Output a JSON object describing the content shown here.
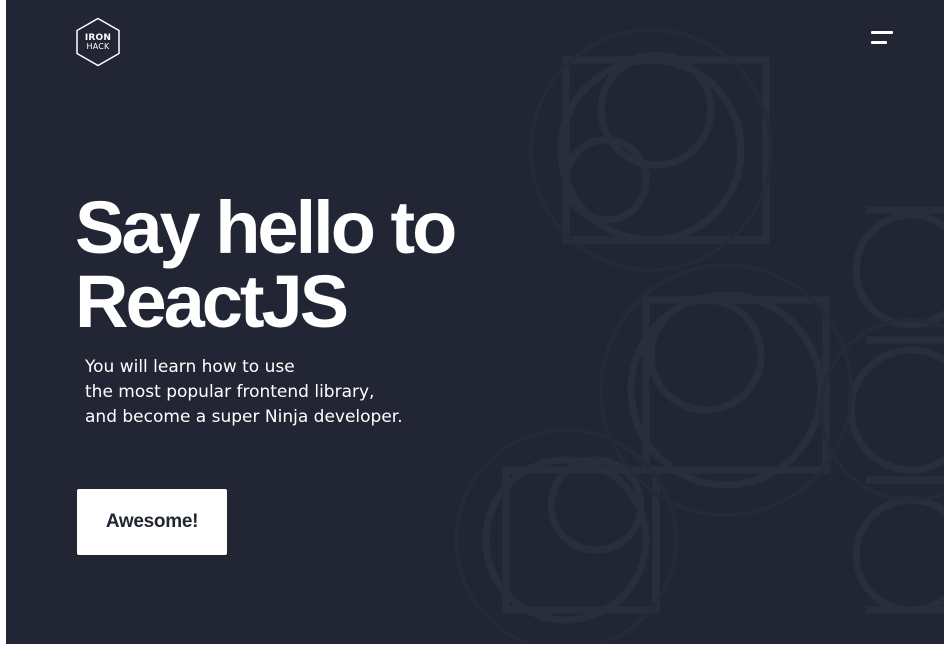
{
  "logo": {
    "line1": "IRON",
    "line2": "HACK"
  },
  "menu": {
    "icon": "hamburger-menu-icon"
  },
  "hero": {
    "title_line1": "Say hello to",
    "title_line2": "ReactJS",
    "subtitle_lines": [
      "You will learn how to use",
      "the most popular frontend library,",
      "and become a super Ninja developer."
    ],
    "cta_label": "Awesome!"
  },
  "colors": {
    "background": "#222634",
    "text": "#ffffff",
    "button_background": "#ffffff",
    "button_text": "#222634"
  }
}
